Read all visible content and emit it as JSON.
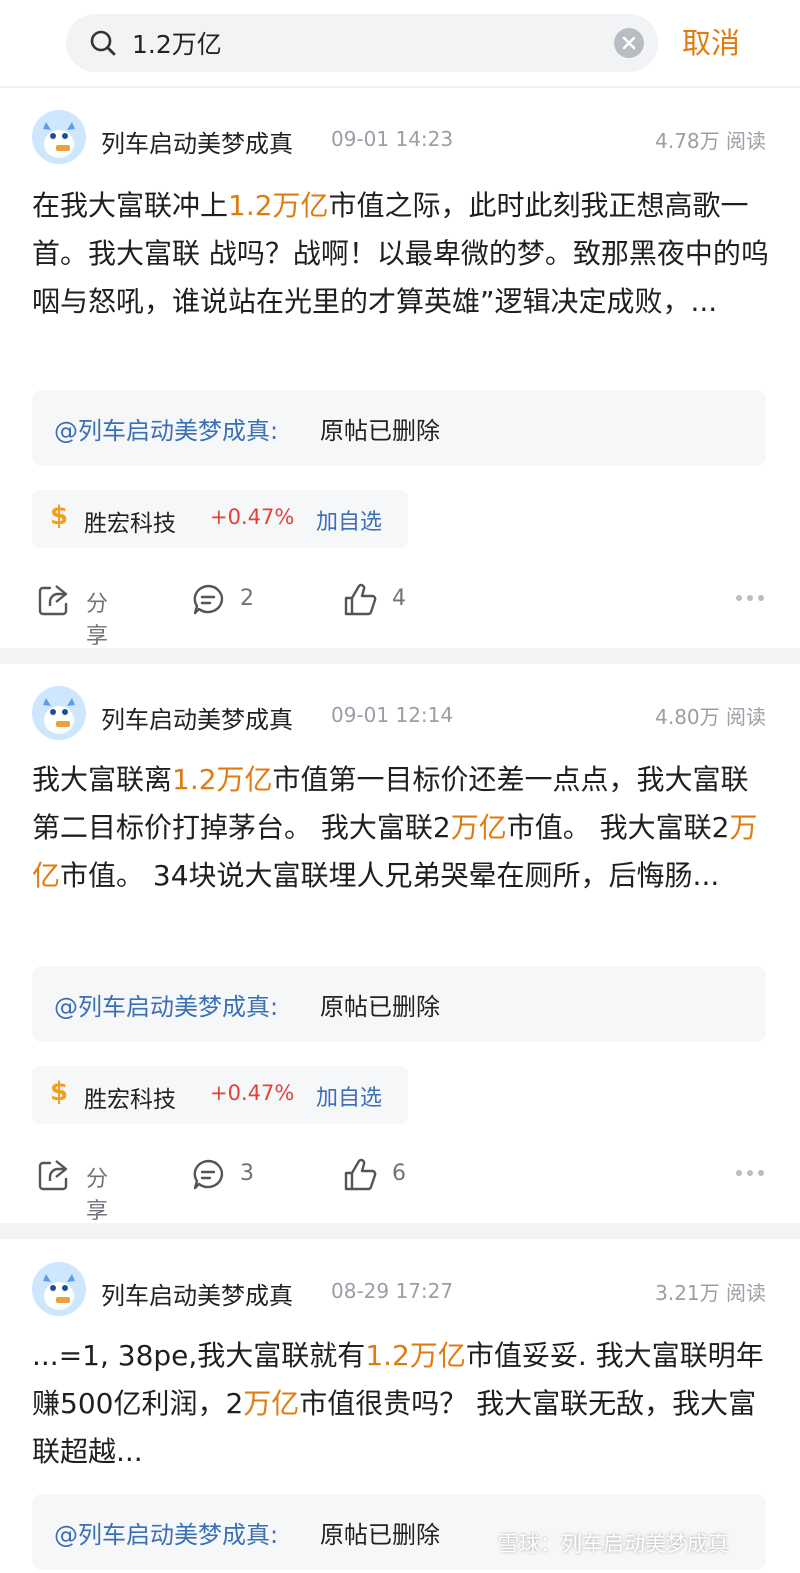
{
  "search": {
    "value": "1.2万亿",
    "cancel_label": "取消"
  },
  "posts": [
    {
      "author": "列车启动美梦成真",
      "time": "09-01 14:23",
      "reads": "4.78万 阅读",
      "text": [
        {
          "t": "在我大富联冲上",
          "hl": false
        },
        {
          "t": "1.2万亿",
          "hl": true
        },
        {
          "t": "市值之际，此时此刻我正想高歌一首。我大富联 战吗？战啊！以最卑微的梦。致那黑夜中的呜咽与怒吼，谁说站在光里的才算英雄”逻辑决定成败，...",
          "hl": false
        }
      ],
      "quote": {
        "mention": "@列车启动美梦成真:",
        "text": "原帖已删除"
      },
      "stock": {
        "name": "胜宏科技",
        "change": "+0.47%",
        "add_label": "加自选"
      },
      "share_label": "分享",
      "comments": "2",
      "likes": "4"
    },
    {
      "author": "列车启动美梦成真",
      "time": "09-01 12:14",
      "reads": "4.80万 阅读",
      "text": [
        {
          "t": "我大富联离",
          "hl": false
        },
        {
          "t": "1.2万亿",
          "hl": true
        },
        {
          "t": "市值第一目标价还差一点点，我大富联第二目标价打掉茅台。 我大富联2",
          "hl": false
        },
        {
          "t": "万亿",
          "hl": true
        },
        {
          "t": "市值。 我大富联2",
          "hl": false
        },
        {
          "t": "万亿",
          "hl": true
        },
        {
          "t": "市值。 34块说大富联埋人兄弟哭晕在厕所，后悔肠...",
          "hl": false
        }
      ],
      "quote": {
        "mention": "@列车启动美梦成真:",
        "text": "原帖已删除"
      },
      "stock": {
        "name": "胜宏科技",
        "change": "+0.47%",
        "add_label": "加自选"
      },
      "share_label": "分享",
      "comments": "3",
      "likes": "6"
    },
    {
      "author": "列车启动美梦成真",
      "time": "08-29 17:27",
      "reads": "3.21万 阅读",
      "text": [
        {
          "t": "...=1, 38pe,我大富联就有",
          "hl": false
        },
        {
          "t": "1.2万亿",
          "hl": true
        },
        {
          "t": "市值妥妥. 我大富联明年赚500亿利润，2",
          "hl": false
        },
        {
          "t": "万亿",
          "hl": true
        },
        {
          "t": "市值很贵吗？ 我大富联无敌，我大富联超越...",
          "hl": false
        }
      ],
      "quote": {
        "mention": "@列车启动美梦成真:",
        "text": "原帖已删除"
      }
    }
  ],
  "watermark": "雪球：列车启动美梦成真",
  "colors": {
    "accent": "#e07b10",
    "link": "#3b6fb6",
    "up": "#e0433a",
    "muted": "#9a9ea6"
  }
}
